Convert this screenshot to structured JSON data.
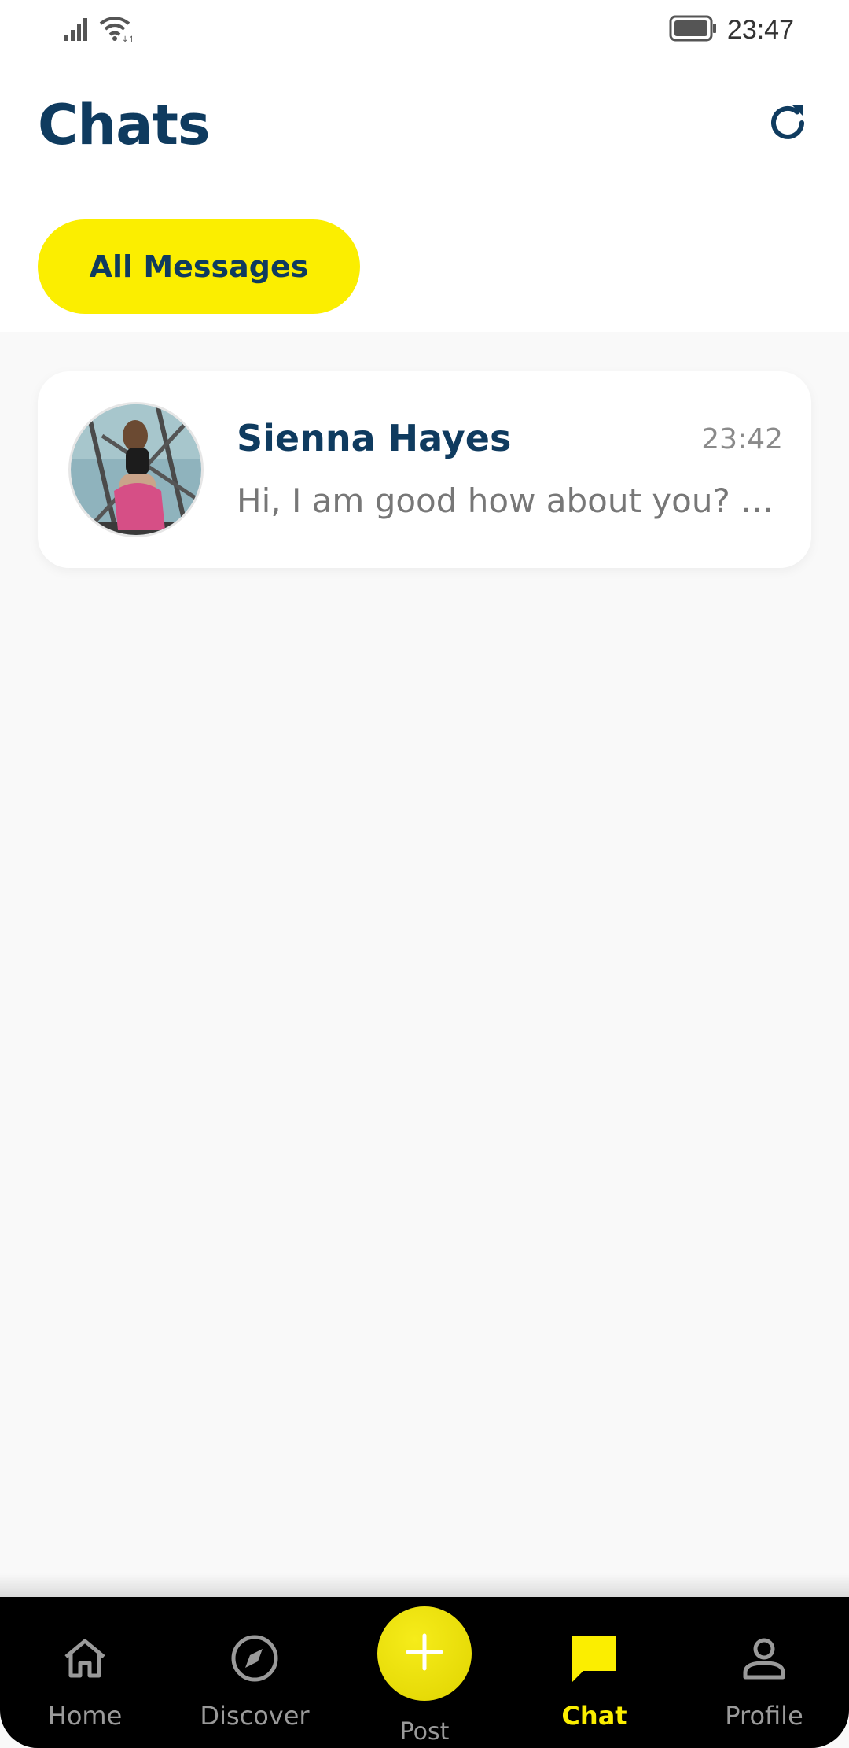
{
  "status_bar": {
    "time": "23:47",
    "icons": [
      "signal-icon",
      "wifi-icon",
      "battery-icon"
    ]
  },
  "header": {
    "title": "Chats",
    "refresh_icon": "refresh-icon"
  },
  "filter": {
    "label": "All Messages"
  },
  "chats": [
    {
      "name": "Sienna Hayes",
      "time": "23:42",
      "preview": "Hi, I am good how about you? …"
    }
  ],
  "bottom_nav": {
    "items": [
      {
        "label": "Home",
        "icon": "home-icon",
        "active": false
      },
      {
        "label": "Discover",
        "icon": "compass-icon",
        "active": false
      },
      {
        "label": "Post",
        "icon": "plus-icon",
        "active": false
      },
      {
        "label": "Chat",
        "icon": "chat-bubble-icon",
        "active": true
      },
      {
        "label": "Profile",
        "icon": "person-icon",
        "active": false
      }
    ]
  },
  "colors": {
    "accent": "#fbee00",
    "primary": "#0f3b5f",
    "background": "#f9f9f9",
    "nav_background": "#000000"
  }
}
